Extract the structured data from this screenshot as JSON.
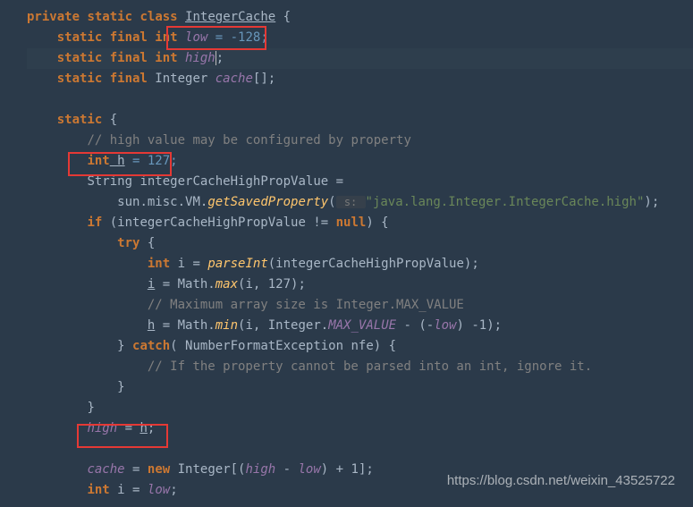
{
  "code": {
    "line1_private": "private",
    "line1_static": "static",
    "line1_class": "class",
    "line1_name": "IntegerCache",
    "line1_brace": " {",
    "line2_mods": "static final int",
    "line2_field": "low",
    "line2_val": " = -128;",
    "line3_mods": "static final int",
    "line3_field": "high",
    "line3_end": ";",
    "line4_mods": "static final",
    "line4_type": " Integer ",
    "line4_field": "cache",
    "line4_end": "[];",
    "line6_static": "static",
    "line6_brace": " {",
    "line7_comment": "// high value may be configured by property",
    "line8_int": "int",
    "line8_var": " h",
    "line8_val": " = 127;",
    "line9_type": "String ",
    "line9_var": "integerCacheHighPropValue =",
    "line10_pre": "sun.misc.VM.",
    "line10_method": "getSavedProperty",
    "line10_open": "(",
    "line10_hint": " s: ",
    "line10_str": "\"java.lang.Integer.IntegerCache.high\"",
    "line10_close": ");",
    "line11_if": "if",
    "line11_cond": " (integerCacheHighPropValue != ",
    "line11_null": "null",
    "line11_close": ") {",
    "line12_try": "try",
    "line12_brace": " {",
    "line13_int": "int",
    "line13_var": " i = ",
    "line13_method": "parseInt",
    "line13_args": "(integerCacheHighPropValue);",
    "line14_var": "i",
    "line14_eq": " = Math.",
    "line14_method": "max",
    "line14_args": "(i, 127);",
    "line15_comment": "// Maximum array size is Integer.MAX_VALUE",
    "line16_var": "h",
    "line16_eq": " = Math.",
    "line16_method": "min",
    "line16_open": "(i, Integer.",
    "line16_const": "MAX_VALUE",
    "line16_mid": " - (-",
    "line16_low": "low",
    "line16_close": ") -1);",
    "line17_catch": "} ",
    "line17_kw": "catch",
    "line17_args": "( NumberFormatException nfe) {",
    "line18_comment": "// If the property cannot be parsed into an int, ignore it.",
    "line19_brace": "}",
    "line20_brace": "}",
    "line21_high": "high",
    "line21_eq": " = ",
    "line21_h": "h",
    "line21_end": ";",
    "line23_cache": "cache",
    "line23_eq": " = ",
    "line23_new": "new",
    "line23_type": " Integer[(",
    "line23_high": "high",
    "line23_minus": " - ",
    "line23_low": "low",
    "line23_close": ") + 1];",
    "line24_int": "int",
    "line24_var": " i = ",
    "line24_low": "low",
    "line24_end": ";"
  },
  "watermark": "https://blog.csdn.net/weixin_43525722"
}
